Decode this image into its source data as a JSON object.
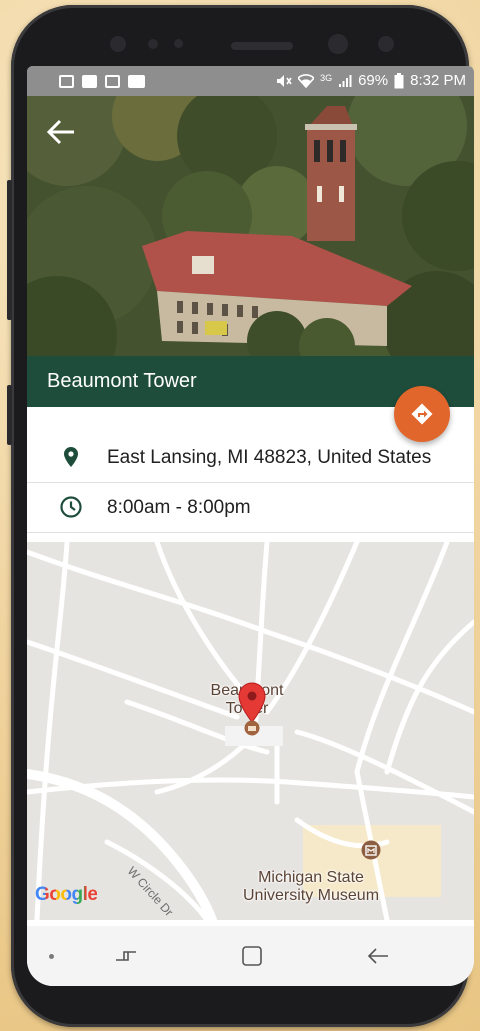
{
  "status_bar": {
    "battery_percent": "69%",
    "time": "8:32 PM",
    "network": "3G"
  },
  "header": {
    "back_icon": "arrow-left-icon",
    "title": "Beaumont Tower"
  },
  "directions_button": {
    "icon": "directions-icon",
    "color": "#e0662c"
  },
  "details": {
    "address": "East Lansing, MI 48823, United States",
    "hours": "8:00am - 8:00pm"
  },
  "map": {
    "marker_label_line1": "Beaumont",
    "marker_label_line2": "Tower",
    "museum_label_line1": "Michigan State",
    "museum_label_line2": "University Museum",
    "street_label": "W Circle Dr",
    "attribution": "Google"
  },
  "colors": {
    "title_bar": "#1e4d3b",
    "accent": "#e0662c",
    "map_marker": "#e53935"
  }
}
